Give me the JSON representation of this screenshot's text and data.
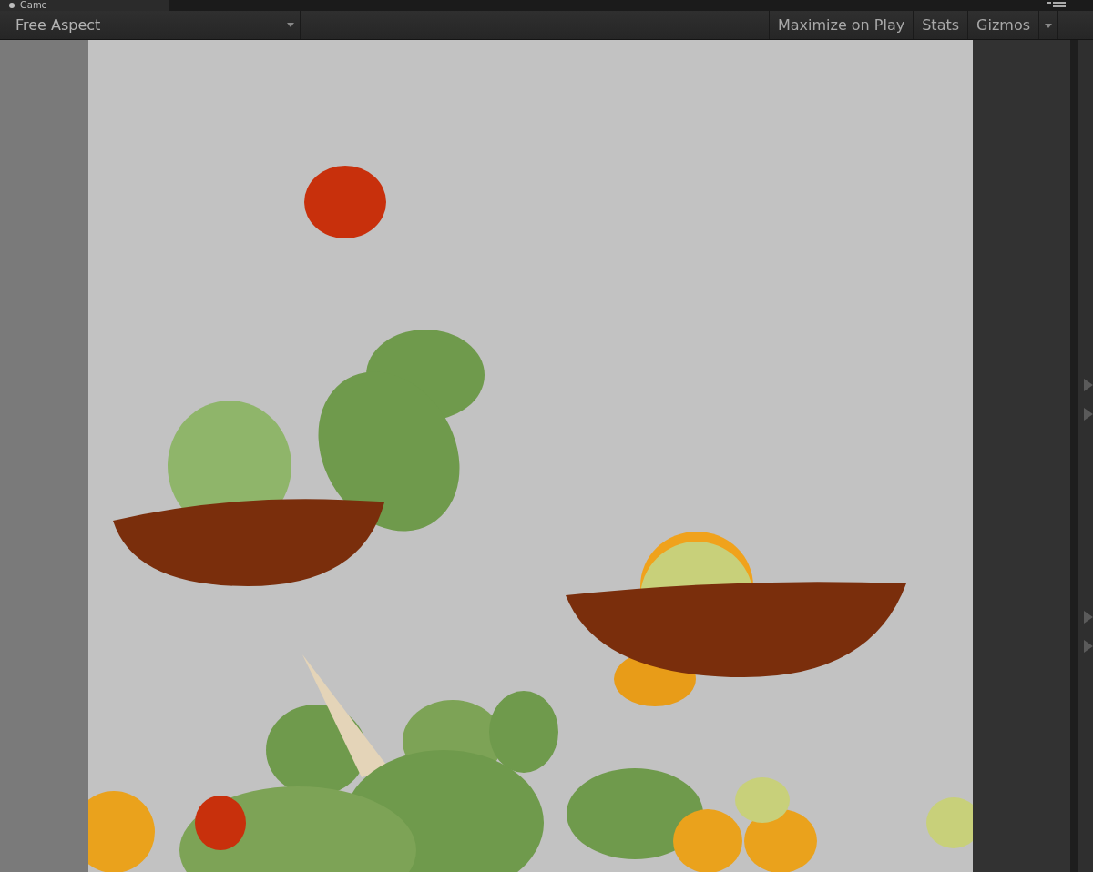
{
  "tab": {
    "title": "Game"
  },
  "toolbar": {
    "aspect_dropdown": "Free Aspect",
    "buttons": [
      {
        "label": "Maximize on Play",
        "kind": "toggle"
      },
      {
        "label": "Stats",
        "kind": "toggle"
      },
      {
        "label": "Gizmos",
        "kind": "dropdown"
      }
    ]
  }
}
